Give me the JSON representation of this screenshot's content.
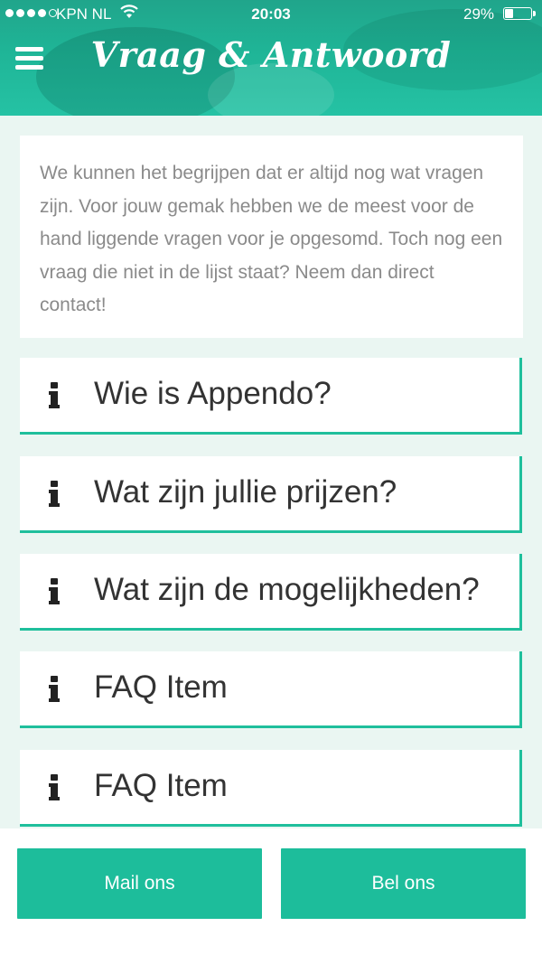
{
  "status_bar": {
    "carrier": "KPN NL",
    "time": "20:03",
    "battery_percent": "29%",
    "battery_level": 0.29,
    "signal_filled": 4,
    "signal_total": 5
  },
  "header": {
    "title": "Vraag & Antwoord",
    "menu_icon": "hamburger-menu-icon"
  },
  "intro": {
    "text": "We kunnen het begrijpen dat er altijd nog wat vragen zijn. Voor jouw gemak hebben we de meest voor de hand liggende vragen voor je opgesomd. Toch nog een vraag die niet in de lijst staat? Neem dan direct contact!"
  },
  "faq": {
    "icon": "info-icon",
    "items": [
      {
        "label": "Wie is Appendo?"
      },
      {
        "label": "Wat zijn jullie prijzen?"
      },
      {
        "label": "Wat zijn de mogelijkheden?"
      },
      {
        "label": "FAQ Item"
      },
      {
        "label": "FAQ Item"
      }
    ]
  },
  "actions": {
    "mail_label": "Mail ons",
    "call_label": "Bel ons"
  },
  "colors": {
    "accent": "#1dbd9b",
    "header": "#20a58b",
    "background": "#eaf6f2",
    "text": "#333333",
    "muted_text": "#8a8a8a"
  }
}
